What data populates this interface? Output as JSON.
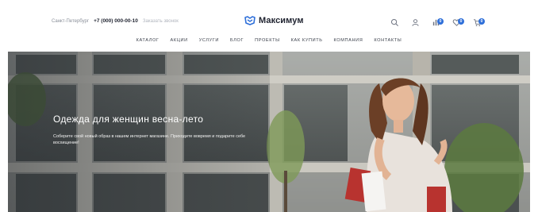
{
  "header": {
    "city": "Санкт-Петербург",
    "phone": "+7 (000) 000-00-10",
    "callback": "Заказать звонок",
    "logo_text": "Максимум",
    "icons": {
      "search": "search-icon",
      "account": "user-icon",
      "compare": "compare-icon",
      "favorites": "heart-icon",
      "cart": "cart-icon"
    },
    "badges": {
      "compare": "0",
      "favorites": "0",
      "cart": "0"
    },
    "accent": "#2e6fd9"
  },
  "nav": {
    "items": [
      "Каталог",
      "Акции",
      "Услуги",
      "Блог",
      "Проекты",
      "Как купить",
      "Компания",
      "Контакты"
    ]
  },
  "hero": {
    "title": "Одежда для женщин весна-лето",
    "description": "Соберите свой новый образ в нашем интернет магазине. Приходите вовремя и подарите себе восхищение!"
  }
}
